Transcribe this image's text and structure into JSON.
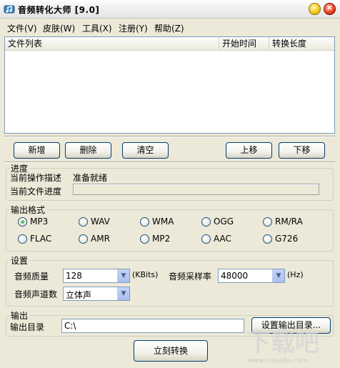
{
  "window": {
    "title": "音频转化大师 [9.0]",
    "minimize_glyph": "–",
    "close_glyph": "×"
  },
  "menu": [
    {
      "label": "文件(V)"
    },
    {
      "label": "皮肤(W)"
    },
    {
      "label": "工具(X)"
    },
    {
      "label": "注册(Y)"
    },
    {
      "label": "帮助(Z)"
    }
  ],
  "file_list": {
    "columns": [
      "文件列表",
      "开始时间",
      "转换长度"
    ],
    "rows": []
  },
  "list_buttons": {
    "add": "新增",
    "delete": "删除",
    "clear": "清空",
    "move_up": "上移",
    "move_down": "下移"
  },
  "progress": {
    "legend": "进度",
    "op_label": "当前操作描述",
    "op_status": "准备就绪",
    "file_label": "当前文件进度",
    "file_progress_percent": 0
  },
  "format": {
    "legend": "输出格式",
    "options": [
      "MP3",
      "WAV",
      "WMA",
      "OGG",
      "RM/RA",
      "FLAC",
      "AMR",
      "MP2",
      "AAC",
      "G726"
    ],
    "selected": "MP3"
  },
  "settings": {
    "legend": "设置",
    "quality_label": "音频质量",
    "quality_value": "128",
    "quality_unit": "(KBits)",
    "samplerate_label": "音频采样率",
    "samplerate_value": "48000",
    "samplerate_unit": "(Hz)",
    "channel_label": "音频声道数",
    "channel_value": "立体声"
  },
  "output": {
    "legend": "输出",
    "dir_label": "输出目录",
    "dir_value": "C:\\",
    "set_dir_button": "设置输出目录..."
  },
  "convert_button": "立刻转换",
  "watermark_text": "www.xiazaiba.com",
  "colors": {
    "window_bg": "#ece9d8",
    "button_border": "#003c74",
    "field_border": "#7f9db9"
  }
}
